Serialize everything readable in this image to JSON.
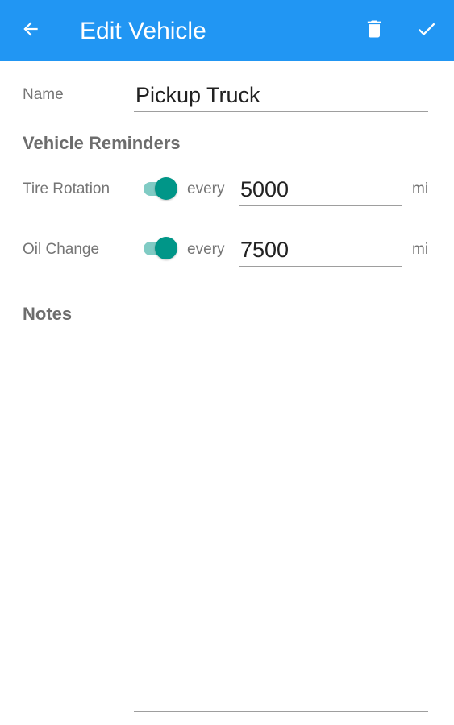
{
  "toolbar": {
    "title": "Edit Vehicle",
    "back_icon": "arrow-left-icon",
    "delete_icon": "trash-icon",
    "save_icon": "check-icon",
    "background_color": "#2196f3",
    "foreground_color": "#ffffff"
  },
  "vehicle": {
    "name_label": "Name",
    "name_value": "Pickup Truck"
  },
  "reminders": {
    "header": "Vehicle Reminders",
    "accent_color": "#009688",
    "items": [
      {
        "label": "Tire Rotation",
        "enabled": true,
        "every_label": "every",
        "interval": "5000",
        "unit": "mi"
      },
      {
        "label": "Oil Change",
        "enabled": true,
        "every_label": "every",
        "interval": "7500",
        "unit": "mi"
      }
    ]
  },
  "notes": {
    "header": "Notes",
    "value": ""
  }
}
